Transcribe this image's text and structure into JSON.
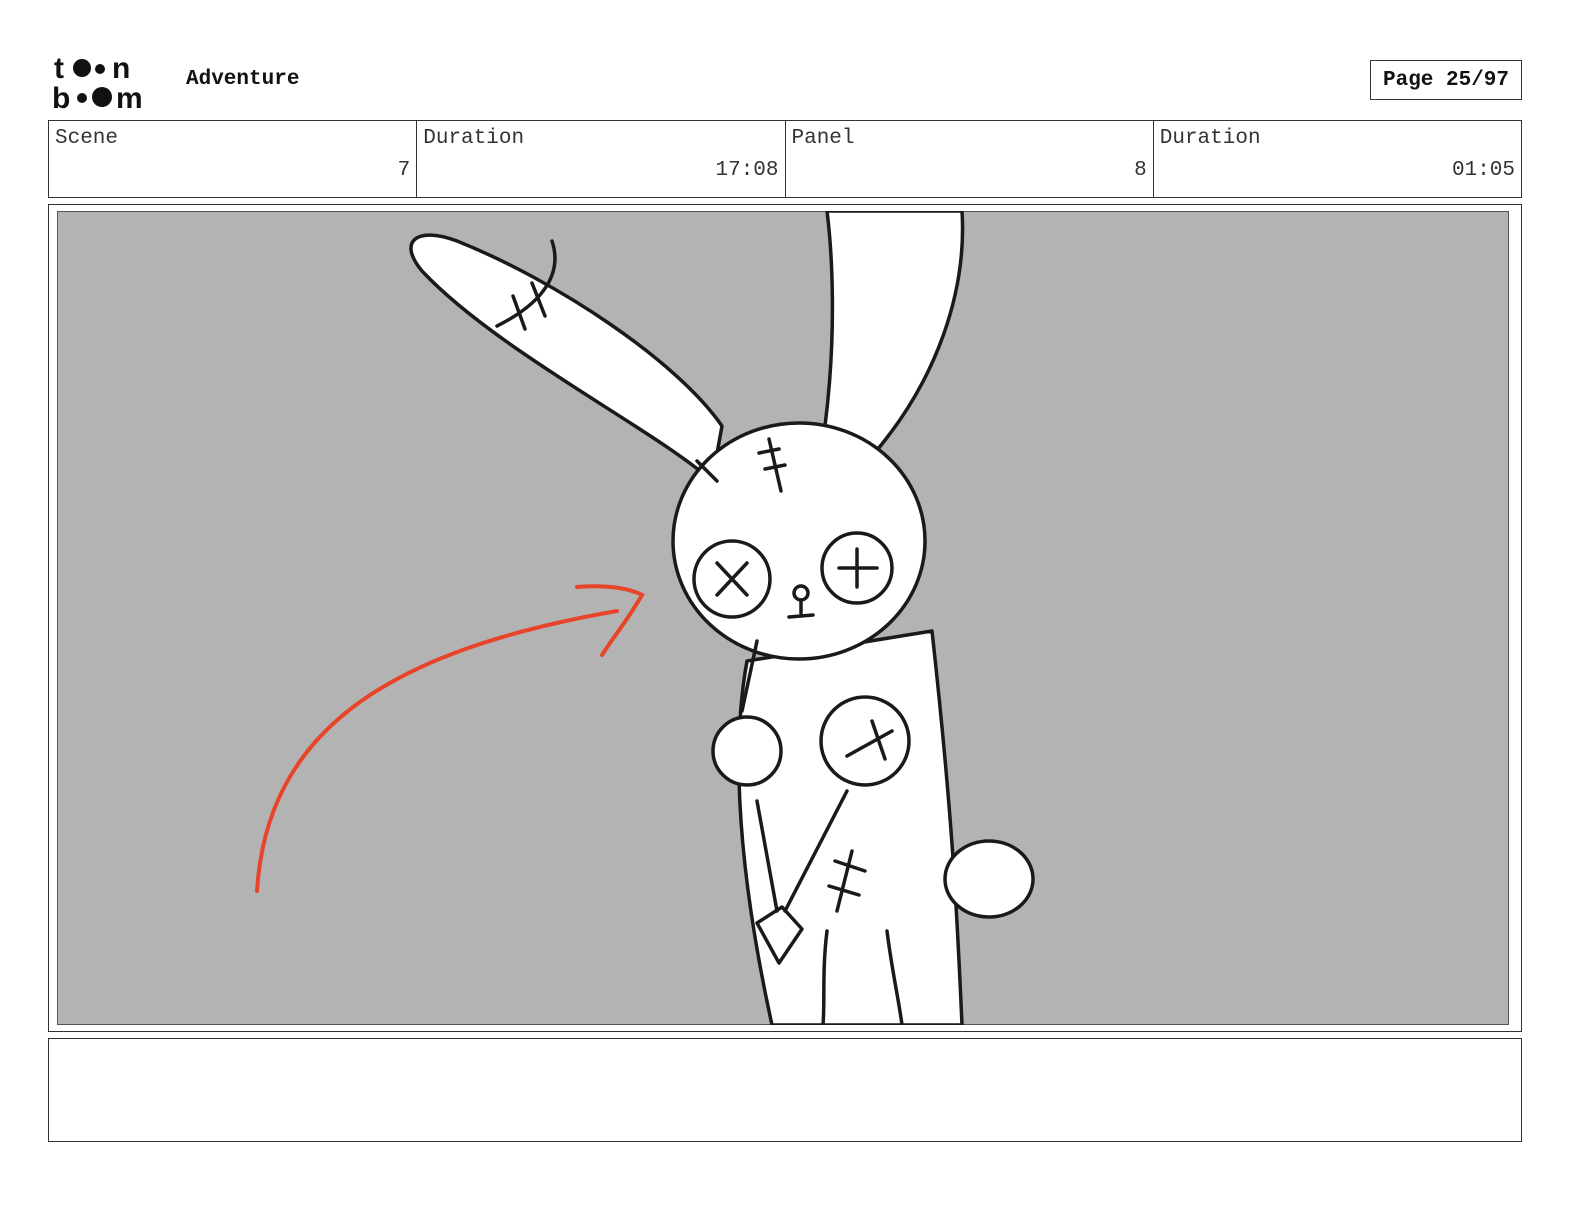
{
  "header": {
    "logo_top": "to•n",
    "logo_bottom": "b••m",
    "project_title": "Adventure",
    "page_label": "Page 25/97"
  },
  "info": {
    "scene_label": "Scene",
    "scene_value": "7",
    "scene_duration_label": "Duration",
    "scene_duration_value": "17:08",
    "panel_label": "Panel",
    "panel_value": "8",
    "panel_duration_label": "Duration",
    "panel_duration_value": "01:05"
  },
  "panel": {
    "background_color": "#b3b3b3",
    "line_color": "#1a1a1a",
    "arrow_color": "#e8442a"
  },
  "notes": {
    "text": ""
  }
}
